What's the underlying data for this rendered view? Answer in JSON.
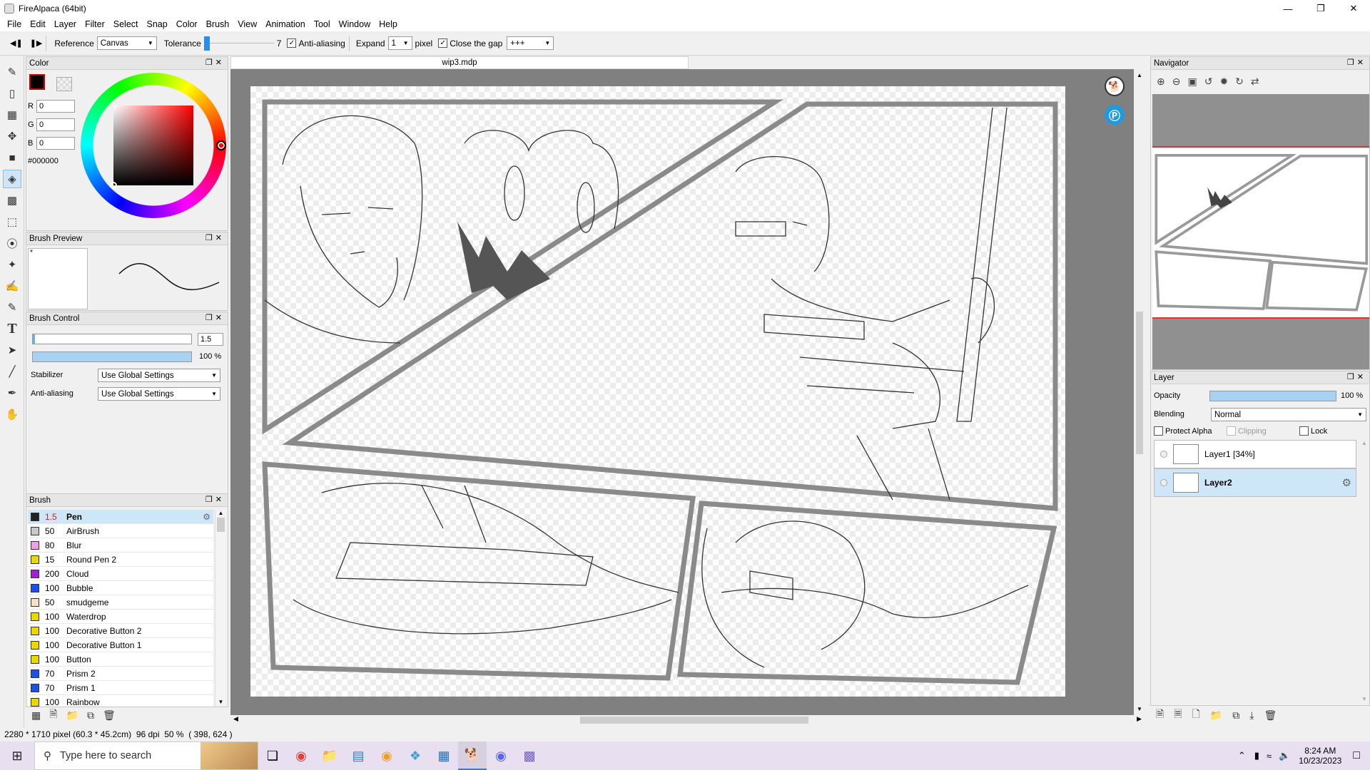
{
  "app": {
    "title": "FireAlpaca (64bit)"
  },
  "menu": [
    "File",
    "Edit",
    "Layer",
    "Filter",
    "Select",
    "Snap",
    "Color",
    "Brush",
    "View",
    "Animation",
    "Tool",
    "Window",
    "Help"
  ],
  "toolbar": {
    "reference_label": "Reference",
    "reference_value": "Canvas",
    "tolerance_label": "Tolerance",
    "tolerance_value": "7",
    "antialiasing_label": "Anti-aliasing",
    "expand_label": "Expand",
    "expand_value": "1",
    "pixel_label": "pixel",
    "close_gap_label": "Close the gap",
    "close_gap_value": "+++"
  },
  "color_panel": {
    "title": "Color",
    "r_label": "R",
    "r_value": "0",
    "g_label": "G",
    "g_value": "0",
    "b_label": "B",
    "b_value": "0",
    "hex": "#000000",
    "primary_color": "#000000"
  },
  "brush_preview": {
    "title": "Brush Preview",
    "mark": "*"
  },
  "brush_control": {
    "title": "Brush Control",
    "size_value": "1.5",
    "opacity_value": "100 %",
    "opacity_fraction": 1.0,
    "stabilizer_label": "Stabilizer",
    "stabilizer_value": "Use Global Settings",
    "antialiasing_label": "Anti-aliasing",
    "antialiasing_value": "Use Global Settings"
  },
  "brush_panel": {
    "title": "Brush",
    "items": [
      {
        "size": "1.5",
        "name": "Pen",
        "color": "#222222"
      },
      {
        "size": "50",
        "name": "AirBrush",
        "color": "#c8c8c8"
      },
      {
        "size": "80",
        "name": "Blur",
        "color": "#f0a0e8"
      },
      {
        "size": "15",
        "name": "Round Pen 2",
        "color": "#e8d800"
      },
      {
        "size": "200",
        "name": "Cloud",
        "color": "#a020d0"
      },
      {
        "size": "100",
        "name": "Bubble",
        "color": "#2050e0"
      },
      {
        "size": "50",
        "name": "smudgeme",
        "color": "#f5e0c8"
      },
      {
        "size": "100",
        "name": "Waterdrop",
        "color": "#e8d800"
      },
      {
        "size": "100",
        "name": "Decorative Button 2",
        "color": "#e8d800"
      },
      {
        "size": "100",
        "name": "Decorative Button 1",
        "color": "#e8d800"
      },
      {
        "size": "100",
        "name": "Button",
        "color": "#e8d800"
      },
      {
        "size": "70",
        "name": "Prism 2",
        "color": "#2050e0"
      },
      {
        "size": "70",
        "name": "Prism 1",
        "color": "#2050e0"
      },
      {
        "size": "100",
        "name": "Rainbow",
        "color": "#e8d800"
      }
    ]
  },
  "document": {
    "tab": "wip3.mdp"
  },
  "navigator": {
    "title": "Navigator"
  },
  "layer_panel": {
    "title": "Layer",
    "opacity_label": "Opacity",
    "opacity_value": "100 %",
    "opacity_fraction": 1.0,
    "blending_label": "Blending",
    "blending_value": "Normal",
    "protect_alpha_label": "Protect Alpha",
    "clipping_label": "Clipping",
    "lock_label": "Lock",
    "layers": [
      {
        "name": "Layer1 [34%]"
      },
      {
        "name": "Layer2"
      }
    ]
  },
  "status": {
    "size": "2280 * 1710 pixel",
    "cm": "(60.3 * 45.2cm)",
    "dpi": "96 dpi",
    "zoom": "50 %",
    "coords": "( 398, 624 )"
  },
  "taskbar": {
    "search_placeholder": "Type here to search",
    "time": "8:24 AM",
    "date": "10/23/2023"
  }
}
